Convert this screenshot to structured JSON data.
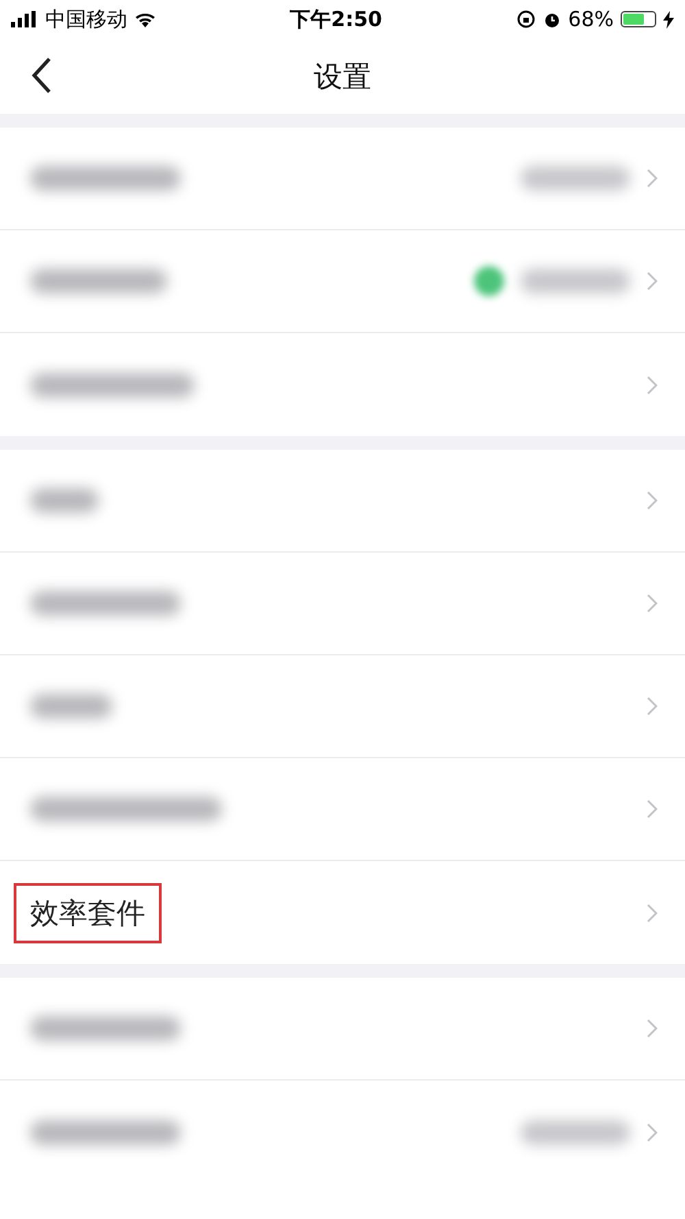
{
  "status_bar": {
    "carrier": "中国移动",
    "time": "下午2:50",
    "battery": "68%",
    "charging": true
  },
  "nav": {
    "title": "设置"
  },
  "groups": [
    {
      "rows": [
        {
          "kind": "blurred",
          "value_blurred": true,
          "dot": false,
          "highlighted": false
        },
        {
          "kind": "blurred",
          "value_blurred": true,
          "dot": true,
          "highlighted": false
        },
        {
          "kind": "blurred",
          "value_blurred": false,
          "dot": false,
          "highlighted": false
        }
      ]
    },
    {
      "rows": [
        {
          "kind": "blurred",
          "value_blurred": false,
          "dot": false,
          "highlighted": false
        },
        {
          "kind": "blurred",
          "value_blurred": false,
          "dot": false,
          "highlighted": false
        },
        {
          "kind": "blurred",
          "value_blurred": false,
          "dot": false,
          "highlighted": false
        },
        {
          "kind": "blurred",
          "value_blurred": false,
          "dot": false,
          "highlighted": false
        },
        {
          "kind": "text",
          "label": "效率套件",
          "value_blurred": false,
          "dot": false,
          "highlighted": true
        }
      ]
    },
    {
      "rows": [
        {
          "kind": "blurred",
          "value_blurred": false,
          "dot": false,
          "highlighted": false
        },
        {
          "kind": "blurred",
          "value_blurred": true,
          "dot": false,
          "highlighted": false
        }
      ]
    }
  ]
}
